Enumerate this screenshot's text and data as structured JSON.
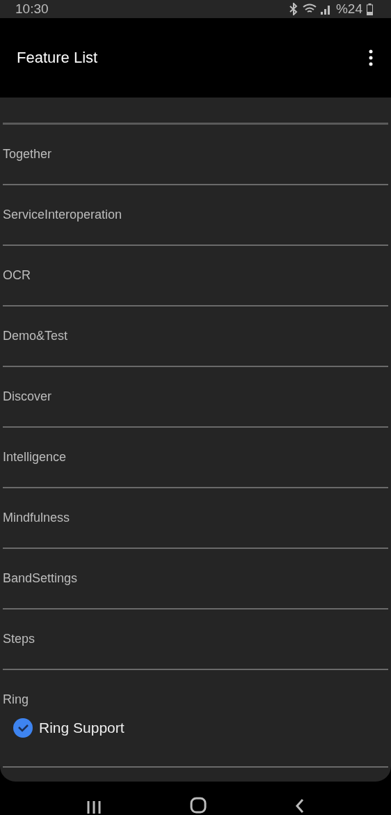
{
  "status_bar": {
    "time": "10:30",
    "battery": "%24"
  },
  "app_bar": {
    "title": "Feature List"
  },
  "features": [
    {
      "label": "Together"
    },
    {
      "label": "ServiceInteroperation"
    },
    {
      "label": "OCR"
    },
    {
      "label": "Demo&Test"
    },
    {
      "label": "Discover"
    },
    {
      "label": "Intelligence"
    },
    {
      "label": "Mindfulness"
    },
    {
      "label": "BandSettings"
    },
    {
      "label": "Steps"
    },
    {
      "label": "Ring",
      "options": [
        {
          "label": "Ring Support",
          "checked": true
        }
      ]
    }
  ]
}
